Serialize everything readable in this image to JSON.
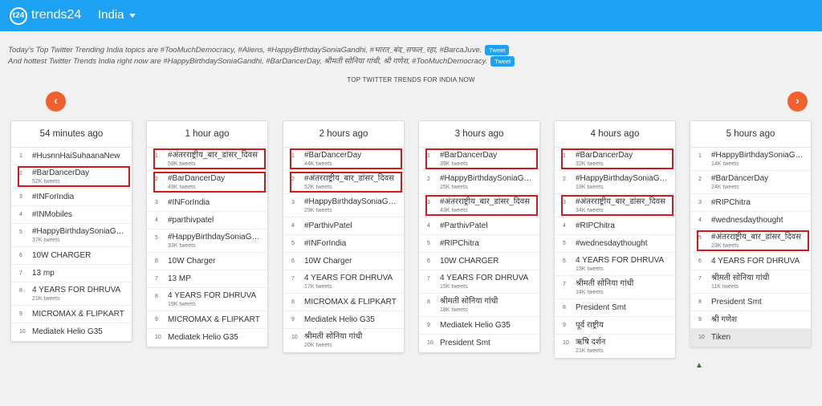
{
  "header": {
    "logo_text": "t24",
    "brand": "trends24",
    "country": "India"
  },
  "summary": {
    "line1": "Today's Top Twitter Trending India topics are #TooMuchDemocracy, #Aliens, #HappyBirthdaySoniaGandhi, #भारत_बंद_सफल_रहा, #BarcaJuve.",
    "line2": "And hottest Twitter Trends India right now are #HappyBirthdaySoniaGandhi, #BarDancerDay, श्रीमती सोनिया गांधी, श्री गणेश, #TooMuchDemocracy.",
    "tweet_label": "Tweet"
  },
  "section_title": "TOP TWITTER TRENDS FOR INDIA NOW",
  "nav": {
    "prev": "‹",
    "next": "›"
  },
  "columns": [
    {
      "title": "54 minutes ago",
      "items": [
        {
          "rank": "1",
          "name": "#HusnnHaiSuhaanaNew",
          "count": ""
        },
        {
          "rank": "2",
          "name": "#BarDancerDay",
          "count": "52K tweets"
        },
        {
          "rank": "3",
          "name": "#INForIndia",
          "count": ""
        },
        {
          "rank": "4",
          "name": "#INMobiles",
          "count": ""
        },
        {
          "rank": "5",
          "name": "#HappyBirthdaySoniaGandhi",
          "count": "37K tweets"
        },
        {
          "rank": "6",
          "name": "10W CHARGER",
          "count": ""
        },
        {
          "rank": "7",
          "name": "13 mp",
          "count": ""
        },
        {
          "rank": "8",
          "name": "4 YEARS FOR DHRUVA",
          "count": "21K tweets"
        },
        {
          "rank": "9",
          "name": "MICROMAX & FLIPKART",
          "count": ""
        },
        {
          "rank": "10",
          "name": "Mediatek Helio G35",
          "count": ""
        }
      ]
    },
    {
      "title": "1 hour ago",
      "items": [
        {
          "rank": "1",
          "name": "#अंतरराष्ट्रीय_बार_डांसर_दिवस",
          "count": "59K tweets"
        },
        {
          "rank": "2",
          "name": "#BarDancerDay",
          "count": "49K tweets"
        },
        {
          "rank": "3",
          "name": "#INForIndia",
          "count": ""
        },
        {
          "rank": "4",
          "name": "#parthivpatel",
          "count": ""
        },
        {
          "rank": "5",
          "name": "#HappyBirthdaySoniaGandhi",
          "count": "33K tweets"
        },
        {
          "rank": "6",
          "name": "10W Charger",
          "count": ""
        },
        {
          "rank": "7",
          "name": "13 MP",
          "count": ""
        },
        {
          "rank": "8",
          "name": "4 YEARS FOR DHRUVA",
          "count": "19K tweets"
        },
        {
          "rank": "9",
          "name": "MICROMAX & FLIPKART",
          "count": ""
        },
        {
          "rank": "10",
          "name": "Mediatek Helio G35",
          "count": ""
        }
      ]
    },
    {
      "title": "2 hours ago",
      "items": [
        {
          "rank": "1",
          "name": "#BarDancerDay",
          "count": "44K tweets"
        },
        {
          "rank": "2",
          "name": "#अंतरराष्ट्रीय_बार_डांसर_दिवस",
          "count": "52K tweets"
        },
        {
          "rank": "3",
          "name": "#HappyBirthdaySoniaGandhi",
          "count": "29K tweets"
        },
        {
          "rank": "4",
          "name": "#ParthivPatel",
          "count": ""
        },
        {
          "rank": "5",
          "name": "#INForIndia",
          "count": ""
        },
        {
          "rank": "6",
          "name": "10W Charger",
          "count": ""
        },
        {
          "rank": "7",
          "name": "4 YEARS FOR DHRUVA",
          "count": "17K tweets"
        },
        {
          "rank": "8",
          "name": "MICROMAX & FLIPKART",
          "count": ""
        },
        {
          "rank": "9",
          "name": "Mediatek Helio G35",
          "count": ""
        },
        {
          "rank": "10",
          "name": "श्रीमती सोनिया गांधी",
          "count": "20K tweets"
        }
      ]
    },
    {
      "title": "3 hours ago",
      "items": [
        {
          "rank": "1",
          "name": "#BarDancerDay",
          "count": "39K tweets"
        },
        {
          "rank": "2",
          "name": "#HappyBirthdaySoniaGandhi",
          "count": "25K tweets"
        },
        {
          "rank": "3",
          "name": "#अंतरराष्ट्रीय_बार_डांसर_दिवस",
          "count": "43K tweets"
        },
        {
          "rank": "4",
          "name": "#ParthivPatel",
          "count": ""
        },
        {
          "rank": "5",
          "name": "#RIPChitra",
          "count": ""
        },
        {
          "rank": "6",
          "name": "10W CHARGER",
          "count": ""
        },
        {
          "rank": "7",
          "name": "4 YEARS FOR DHRUVA",
          "count": "15K tweets"
        },
        {
          "rank": "8",
          "name": "श्रीमती सोनिया गांधी",
          "count": "18K tweets"
        },
        {
          "rank": "9",
          "name": "Mediatek Helio G35",
          "count": ""
        },
        {
          "rank": "10",
          "name": "President Smt",
          "count": ""
        }
      ]
    },
    {
      "title": "4 hours ago",
      "items": [
        {
          "rank": "1",
          "name": "#BarDancerDay",
          "count": "32K tweets"
        },
        {
          "rank": "2",
          "name": "#HappyBirthdaySoniaGandhi",
          "count": "19K tweets"
        },
        {
          "rank": "3",
          "name": "#अंतरराष्ट्रीय_बार_डांसर_दिवस",
          "count": "34K tweets"
        },
        {
          "rank": "4",
          "name": "#RIPChitra",
          "count": ""
        },
        {
          "rank": "5",
          "name": "#wednesdaythought",
          "count": ""
        },
        {
          "rank": "6",
          "name": "4 YEARS FOR DHRUVA",
          "count": "13K tweets"
        },
        {
          "rank": "7",
          "name": "श्रीमती सोनिया गांधी",
          "count": "14K tweets"
        },
        {
          "rank": "8",
          "name": "President Smt",
          "count": ""
        },
        {
          "rank": "9",
          "name": "पूर्व राष्ट्रीय",
          "count": ""
        },
        {
          "rank": "10",
          "name": "ऋषि दर्शन",
          "count": "21K tweets"
        }
      ]
    },
    {
      "title": "5 hours ago",
      "items": [
        {
          "rank": "1",
          "name": "#HappyBirthdaySoniaGandhi",
          "count": "14K tweets"
        },
        {
          "rank": "2",
          "name": "#BarDancerDay",
          "count": "24K tweets"
        },
        {
          "rank": "3",
          "name": "#RIPChitra",
          "count": ""
        },
        {
          "rank": "4",
          "name": "#wednesdaythought",
          "count": ""
        },
        {
          "rank": "5",
          "name": "#अंतरराष्ट्रीय_बार_डांसर_दिवस",
          "count": "23K tweets"
        },
        {
          "rank": "6",
          "name": "4 YEARS FOR DHRUVA",
          "count": ""
        },
        {
          "rank": "7",
          "name": "श्रीमती सोनिया गांधी",
          "count": "11K tweets"
        },
        {
          "rank": "8",
          "name": "President Smt",
          "count": ""
        },
        {
          "rank": "9",
          "name": "श्री गणेश",
          "count": ""
        },
        {
          "rank": "10",
          "name": "Tiken",
          "count": ""
        }
      ]
    }
  ],
  "highlight_color": "#d01a1a",
  "accent_color": "#1da1f2",
  "arrow_color": "#f1612d"
}
